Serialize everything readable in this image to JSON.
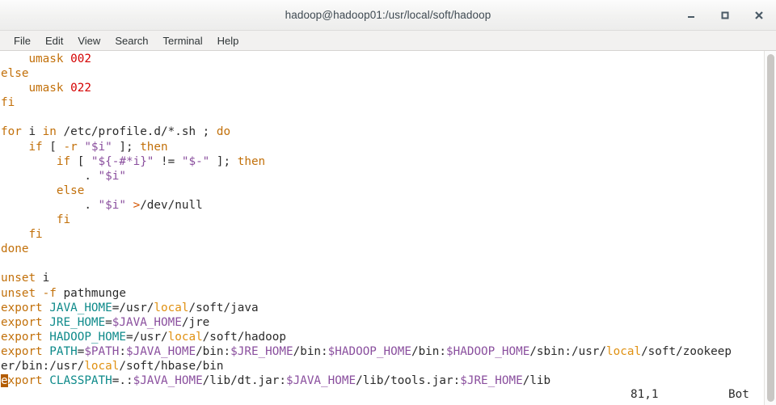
{
  "window": {
    "title": "hadoop@hadoop01:/usr/local/soft/hadoop",
    "controls": {
      "minimize": "minimize-icon",
      "maximize": "maximize-icon",
      "close": "close-icon"
    }
  },
  "menubar": {
    "items": [
      {
        "label": "File"
      },
      {
        "label": "Edit"
      },
      {
        "label": "View"
      },
      {
        "label": "Search"
      },
      {
        "label": "Terminal"
      },
      {
        "label": "Help"
      }
    ]
  },
  "terminal": {
    "application": "vim",
    "colors": {
      "background": "#ffffff",
      "foreground": "#2b2b2b",
      "keyword": "#c2700a",
      "number": "#d40000",
      "variable": "#8a4f9e",
      "identifier": "#0e8a8a",
      "redirect": "#d45500",
      "directory": "#e09112",
      "cursor": "#b35c00"
    },
    "lines": [
      {
        "id": "l1",
        "text": "    umask 002"
      },
      {
        "id": "l2",
        "text": "else"
      },
      {
        "id": "l3",
        "text": "    umask 022"
      },
      {
        "id": "l4",
        "text": "fi"
      },
      {
        "id": "l5",
        "text": ""
      },
      {
        "id": "l6",
        "text": "for i in /etc/profile.d/*.sh ; do"
      },
      {
        "id": "l7",
        "text": "    if [ -r \"$i\" ]; then"
      },
      {
        "id": "l8",
        "text": "        if [ \"${-#*i}\" != \"$-\" ]; then"
      },
      {
        "id": "l9",
        "text": "            . \"$i\""
      },
      {
        "id": "l10",
        "text": "        else"
      },
      {
        "id": "l11",
        "text": "            . \"$i\" >/dev/null"
      },
      {
        "id": "l12",
        "text": "        fi"
      },
      {
        "id": "l13",
        "text": "    fi"
      },
      {
        "id": "l14",
        "text": "done"
      },
      {
        "id": "l15",
        "text": ""
      },
      {
        "id": "l16",
        "text": "unset i"
      },
      {
        "id": "l17",
        "text": "unset -f pathmunge"
      },
      {
        "id": "l18",
        "text": "export JAVA_HOME=/usr/local/soft/java"
      },
      {
        "id": "l19",
        "text": "export JRE_HOME=$JAVA_HOME/jre"
      },
      {
        "id": "l20",
        "text": "export HADOOP_HOME=/usr/local/soft/hadoop"
      },
      {
        "id": "l21",
        "text": "export PATH=$PATH:$JAVA_HOME/bin:$JRE_HOME/bin:$HADOOP_HOME/bin:$HADOOP_HOME/sbin:/usr/local/soft/zookeep"
      },
      {
        "id": "l22",
        "text": "er/bin:/usr/local/soft/hbase/bin"
      },
      {
        "id": "l23",
        "text": "export CLASSPATH=.:$JAVA_HOME/lib/dt.jar:$JAVA_HOME/lib/tools.jar:$JRE_HOME/lib"
      }
    ],
    "statusline": {
      "position": "81,1",
      "scroll": "Bot"
    }
  },
  "scrollbar": {
    "name": "vertical-scrollbar"
  }
}
